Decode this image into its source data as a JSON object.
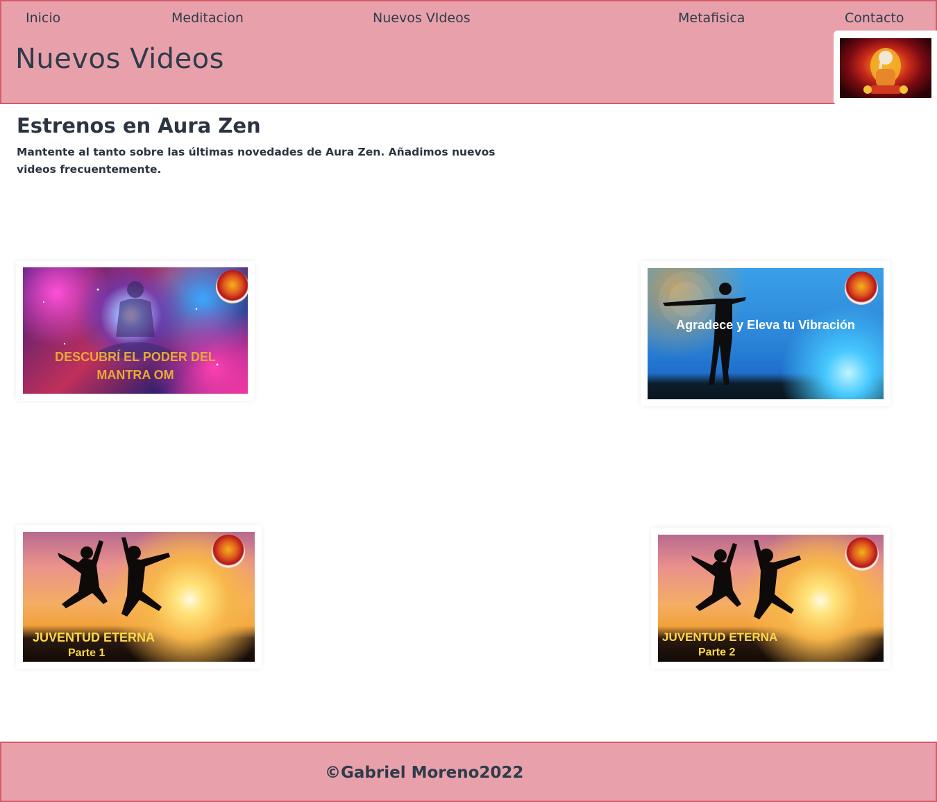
{
  "nav": {
    "items": [
      {
        "label": "Inicio"
      },
      {
        "label": "Meditacion"
      },
      {
        "label": "Nuevos VIdeos"
      },
      {
        "label": "Metafisica"
      },
      {
        "label": "Contacto"
      }
    ]
  },
  "header": {
    "title": "Nuevos Videos"
  },
  "main": {
    "heading": "Estrenos en Aura Zen",
    "description": "Mantente al tanto sobre las últimas novedades de Aura Zen. Añadimos nuevos videos frecuentemente.",
    "videos": [
      {
        "line1": "DESCUBRÍ EL PODER DEL",
        "line2": "MANTRA OM"
      },
      {
        "line1": "Agradece y Eleva tu Vibración"
      },
      {
        "line1": "JUVENTUD ETERNA",
        "line2": "Parte 1"
      },
      {
        "line1": "JUVENTUD ETERNA",
        "line2": "Parte 2"
      }
    ]
  },
  "footer": {
    "copyright": "©Gabriel Moreno2022"
  },
  "colors": {
    "header_bg": "#e8a1ab",
    "header_border": "#d75a68",
    "text": "#2b3440",
    "thumb_text_om": "#e8a93a",
    "thumb_text_jump": "#ffd84a"
  }
}
